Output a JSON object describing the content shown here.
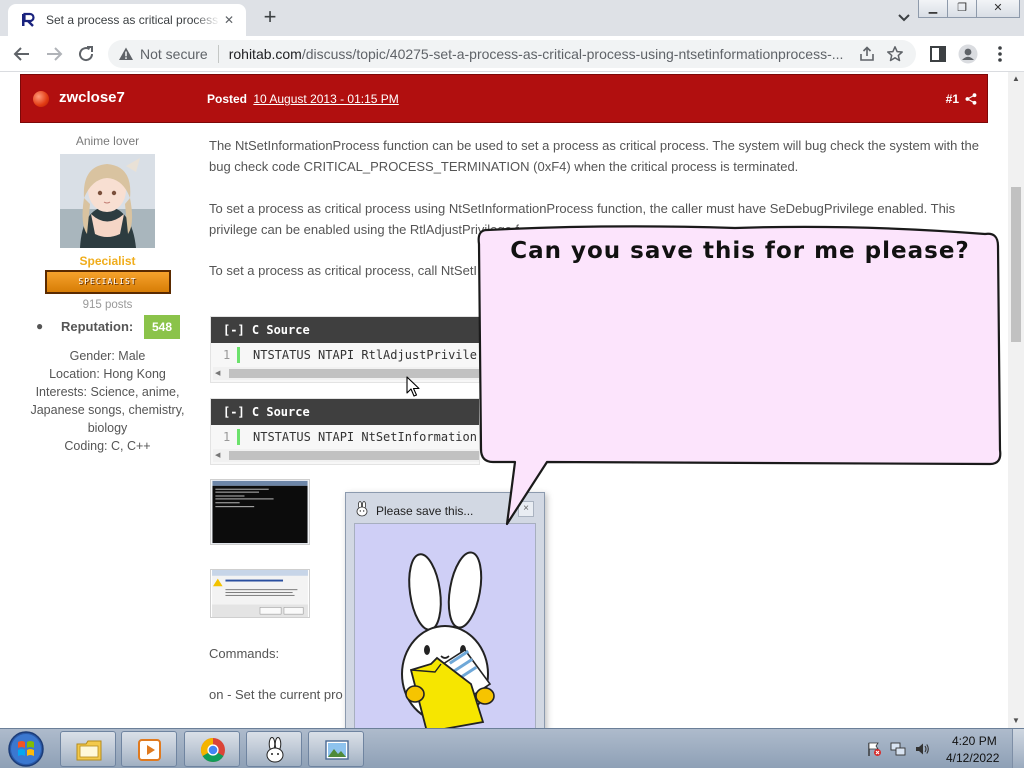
{
  "browser": {
    "tab_title": "Set a process as critical process using NtSetInformationProcess function",
    "security_label": "Not secure",
    "url_host": "rohitab.com",
    "url_path": "/discuss/topic/40275-set-a-process-as-critical-process-using-ntsetinformationprocess-...",
    "icons": [
      "back-arrow-icon",
      "forward-arrow-icon",
      "reload-icon",
      "warning-triangle-icon",
      "share-icon",
      "star-icon",
      "side-panel-icon",
      "profile-icon",
      "more-vertical-icon",
      "new-tab-plus-icon",
      "tab-search-chevron-icon"
    ]
  },
  "post": {
    "author": "zwclose7",
    "posted_label": "Posted",
    "posted_date": "10 August 2013 - 01:15 PM",
    "post_number": "#1",
    "header_color": "#b10f0f"
  },
  "profile": {
    "member_title": "Anime lover",
    "rank_name": "Specialist",
    "rank_badge": "SPECIALIST",
    "posts": "915 posts",
    "reputation_label": "Reputation:",
    "reputation_value": "548",
    "info": [
      {
        "label": "Gender:",
        "value": "Male"
      },
      {
        "label": "Location:",
        "value": "Hong Kong"
      },
      {
        "label": "Interests:",
        "value": "Science, anime,"
      },
      {
        "label": "",
        "value": "Japanese songs, chemistry,"
      },
      {
        "label": "",
        "value": "biology"
      },
      {
        "label": "Coding:",
        "value": "C, C++"
      }
    ]
  },
  "content": {
    "paragraph1": "The NtSetInformationProcess function can be used to set a process as critical process. The system will bug check the system with the bug check code CRITICAL_PROCESS_TERMINATION (0xF4) when the critical process is terminated.",
    "paragraph2": "To set a process as critical process using NtSetInformationProcess function, the caller must have SeDebugPrivilege enabled. This privilege can be enabled using the RtlAdjustPrivilege f",
    "paragraph3": "To set a process as critical process, call NtSetI",
    "code_blocks": [
      {
        "header": "[-] C Source",
        "line_number": "1",
        "code": "NTSTATUS NTAPI RtlAdjustPrivile"
      },
      {
        "header": "[-] C Source",
        "line_number": "1",
        "code": "NTSTATUS NTAPI NtSetInformation"
      }
    ],
    "commands_label": "Commands:",
    "on_line": "on - Set the current pro"
  },
  "overlay": {
    "window_title": "Please save this...",
    "close_label": "×",
    "speech": "Can you save this for me please?",
    "bubble_color": "#fce4fc",
    "body_color": "#cfcff6"
  },
  "taskbar": {
    "time": "4:20 PM",
    "date": "4/12/2022",
    "items": [
      "start-orb-icon",
      "explorer-folder-icon",
      "media-player-icon",
      "chrome-icon",
      "bunny-app-icon",
      "picture-viewer-icon"
    ]
  }
}
